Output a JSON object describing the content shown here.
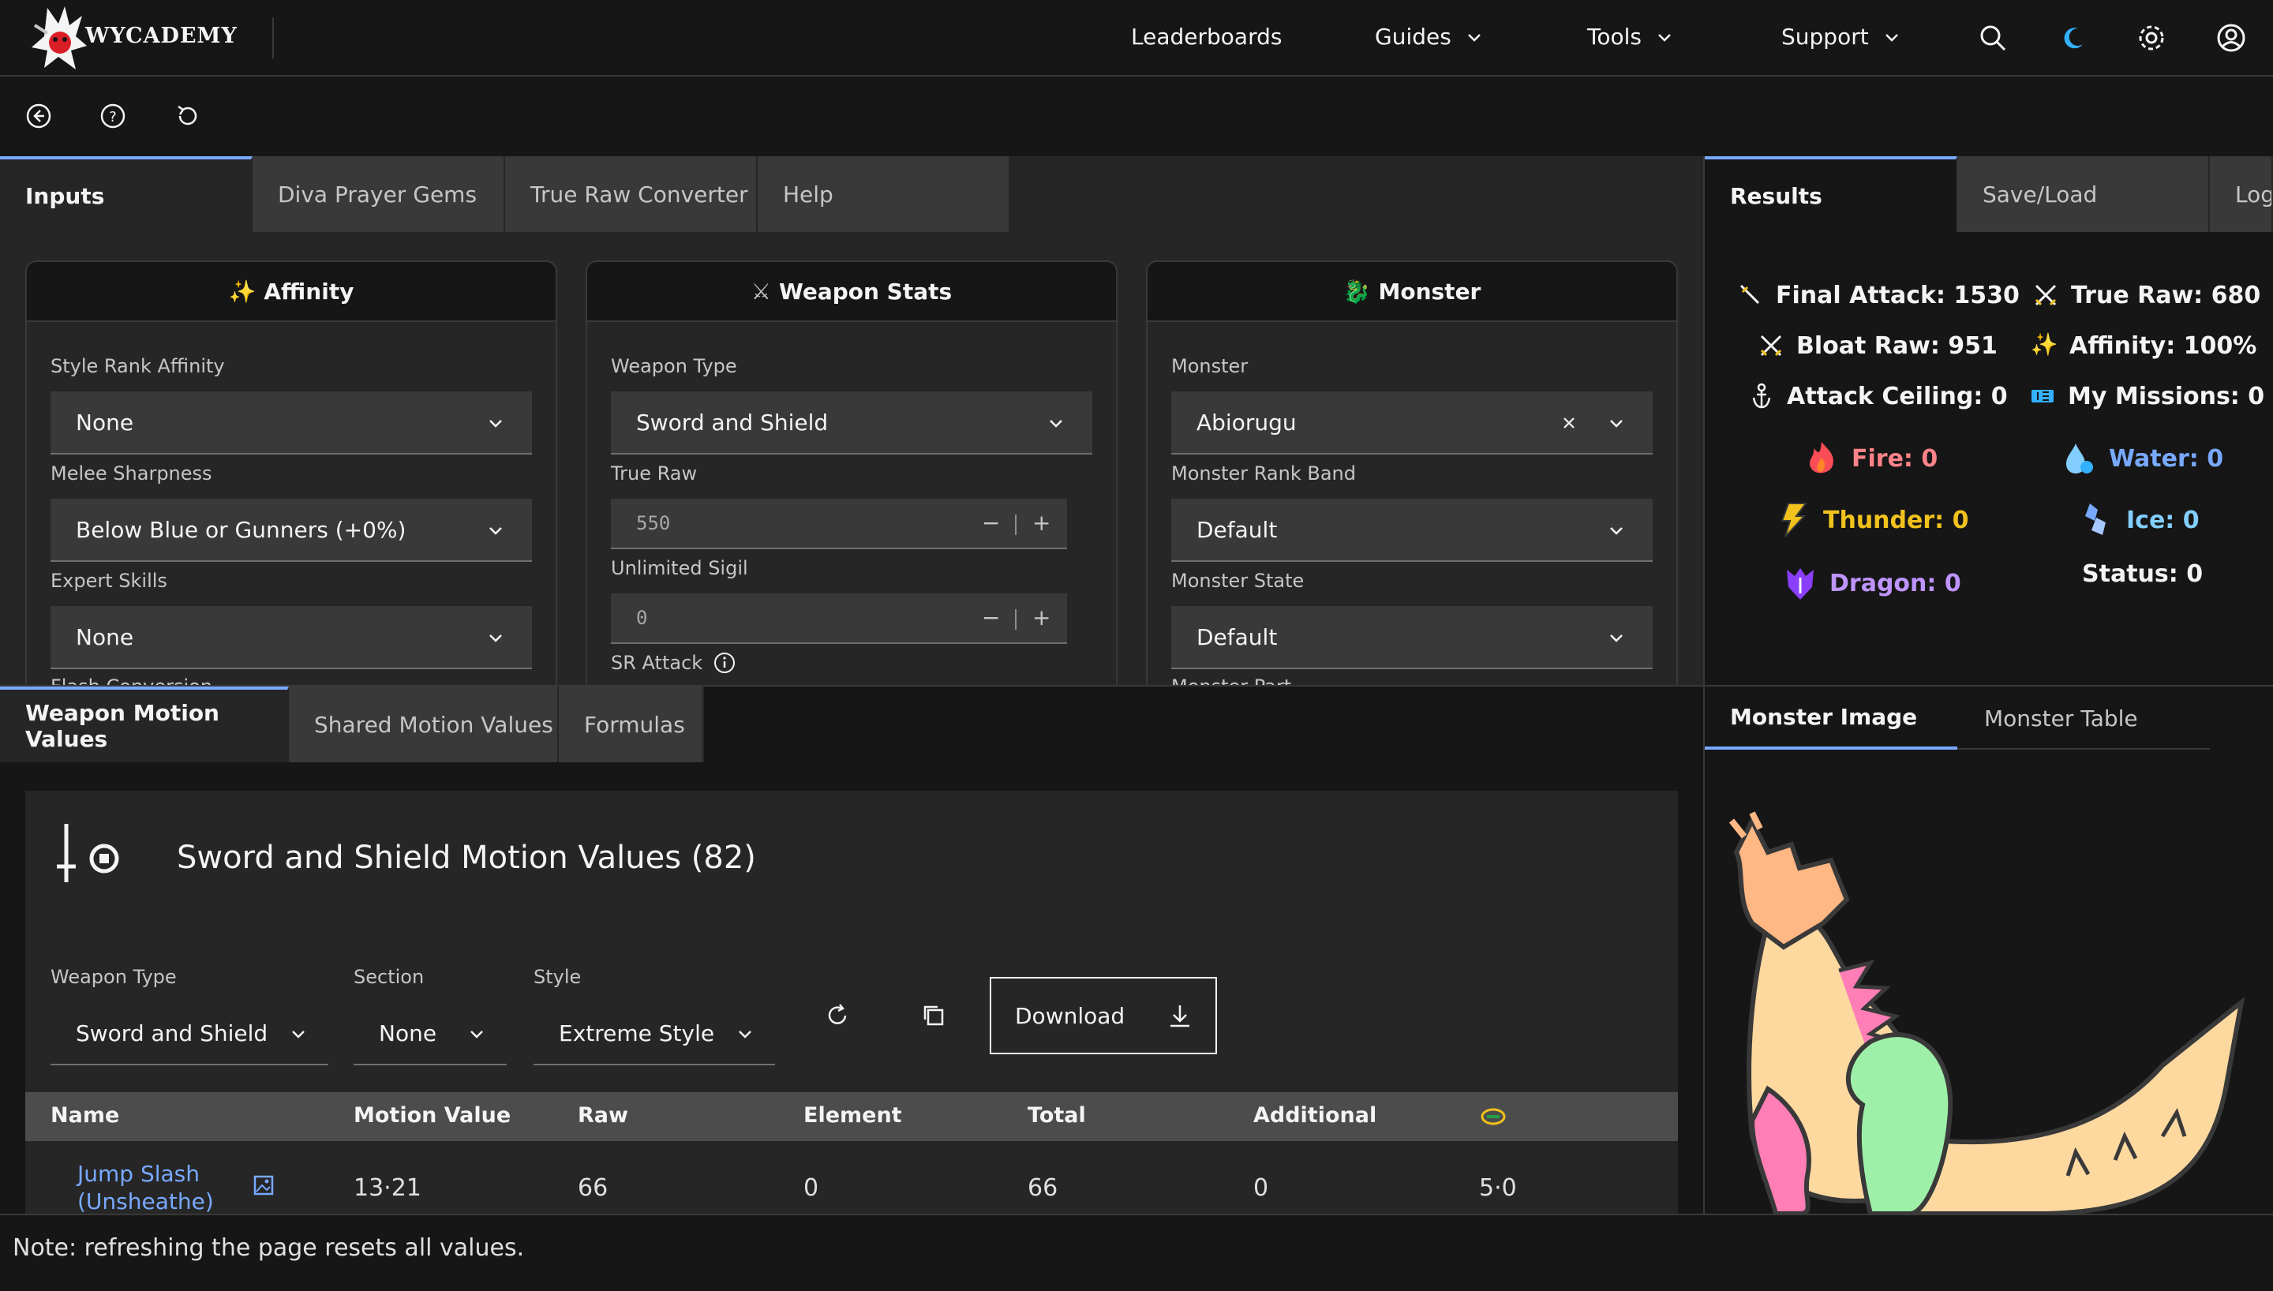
{
  "header": {
    "logo_text": "WYCADEMY",
    "nav": [
      {
        "label": "Leaderboards"
      },
      {
        "label": "Guides"
      },
      {
        "label": "Tools"
      },
      {
        "label": "Support"
      }
    ],
    "icons": [
      "search-icon",
      "theme-toggle-icon",
      "settings-icon",
      "user-icon"
    ]
  },
  "toolbar": {
    "icons": [
      "back-icon",
      "help-icon",
      "reset-icon"
    ]
  },
  "input_tabs": [
    "Inputs",
    "Diva Prayer Gems",
    "True Raw Converter",
    "Help"
  ],
  "result_tabs": [
    "Results",
    "Save/Load",
    "Log"
  ],
  "affinity": {
    "title": "Affinity",
    "style_rank_label": "Style Rank Affinity",
    "style_rank_value": "None",
    "sharpness_label": "Melee Sharpness",
    "sharpness_value": "Below Blue or Gunners (+0%)",
    "expert_label": "Expert Skills",
    "expert_value": "None",
    "cut_label": "Flash Conversion"
  },
  "weapon": {
    "title": "Weapon Stats",
    "type_label": "Weapon Type",
    "type_value": "Sword and Shield",
    "true_raw_label": "True Raw",
    "true_raw_value": "550",
    "sigil_label": "Unlimited Sigil",
    "sigil_value": "0",
    "sr_label": "SR Attack",
    "minus": "−",
    "plus": "+"
  },
  "monster": {
    "title": "Monster",
    "monster_label": "Monster",
    "monster_value": "Abiorugu",
    "band_label": "Monster Rank Band",
    "band_value": "Default",
    "state_label": "Monster State",
    "state_value": "Default",
    "part_label": "Monster Part"
  },
  "results": {
    "final_attack": "Final Attack: 1530",
    "true_raw": "True Raw: 680",
    "bloat_raw": "Bloat Raw: 951",
    "affinity": "Affinity: 100%",
    "attack_ceiling": "Attack Ceiling: 0",
    "missions": "My Missions: 0",
    "fire": "Fire: 0",
    "water": "Water: 0",
    "thunder": "Thunder: 0",
    "ice": "Ice: 0",
    "dragon": "Dragon: 0",
    "status": "Status: 0",
    "colors": {
      "fire": "#ff8389",
      "water": "#78a9ff",
      "thunder": "#f1c21b",
      "ice": "#82cfff",
      "dragon": "#be95ff"
    }
  },
  "motion_tabs": [
    "Weapon Motion Values",
    "Shared Motion Values",
    "Formulas"
  ],
  "monster_tabs": [
    "Monster Image",
    "Monster Table"
  ],
  "motion": {
    "title": "Sword and Shield Motion Values (82)",
    "weapon_type_label": "Weapon Type",
    "weapon_type_value": "Sword and Shield",
    "section_label": "Section",
    "section_value": "None",
    "style_label": "Style",
    "style_value": "Extreme Style",
    "download": "Download",
    "columns": [
      "Name",
      "Motion Value",
      "Raw",
      "Element",
      "Total",
      "Additional"
    ],
    "rows": [
      {
        "name": "Jump Slash (Unsheathe)",
        "motion_value": "13·21",
        "raw": "66",
        "element": "0",
        "total": "66",
        "additional": "0",
        "hits": "5·0"
      }
    ]
  },
  "footer": {
    "note": "Note: refreshing the page resets all values."
  }
}
